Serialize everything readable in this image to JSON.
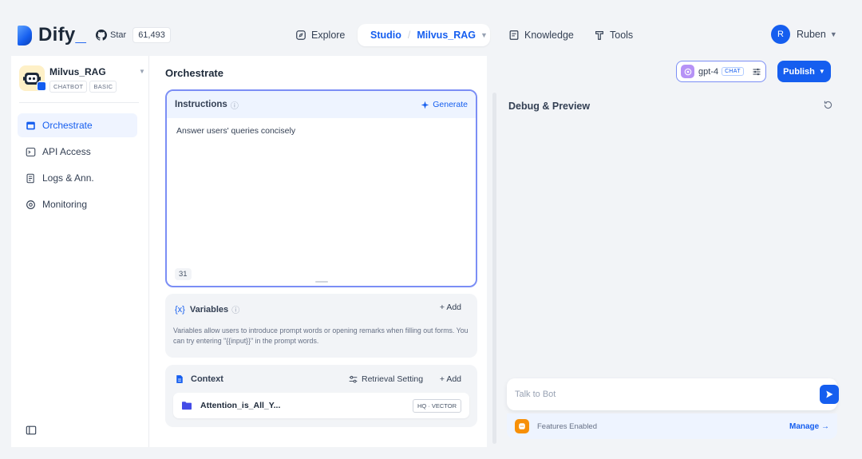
{
  "brand": {
    "name": "Dify",
    "accent": "#155eef"
  },
  "github": {
    "label": "Star",
    "count": "61,493"
  },
  "nav": {
    "explore": "Explore",
    "studio": "Studio",
    "separator": "/",
    "current_app": "Milvus_RAG",
    "knowledge": "Knowledge",
    "tools": "Tools"
  },
  "user": {
    "initial": "R",
    "name": "Ruben"
  },
  "app": {
    "name": "Milvus_RAG",
    "tags": [
      "CHATBOT",
      "BASIC"
    ]
  },
  "sidebar": {
    "items": [
      {
        "label": "Orchestrate",
        "icon": "layout-icon",
        "active": true
      },
      {
        "label": "API Access",
        "icon": "terminal-icon",
        "active": false
      },
      {
        "label": "Logs & Ann.",
        "icon": "file-list-icon",
        "active": false
      },
      {
        "label": "Monitoring",
        "icon": "gauge-icon",
        "active": false
      }
    ]
  },
  "orchestrate": {
    "title": "Orchestrate"
  },
  "instructions": {
    "label": "Instructions",
    "generate": "Generate",
    "text": "Answer users' queries concisely",
    "char_count": "31"
  },
  "variables": {
    "label": "Variables",
    "add": "+ Add",
    "description": "Variables allow users to introduce prompt words or opening remarks when filling out forms. You can try entering \"{{input}}\" in the prompt words."
  },
  "context": {
    "label": "Context",
    "retrieval_setting": "Retrieval Setting",
    "add": "+ Add",
    "dataset_name": "Attention_is_All_Y...",
    "dataset_tag": "HQ · VECTOR"
  },
  "model": {
    "name": "gpt-4",
    "mode": "CHAT"
  },
  "publish": {
    "label": "Publish"
  },
  "debug": {
    "title": "Debug & Preview",
    "input_placeholder": "Talk to Bot",
    "features_label": "Features Enabled",
    "manage": "Manage →"
  }
}
